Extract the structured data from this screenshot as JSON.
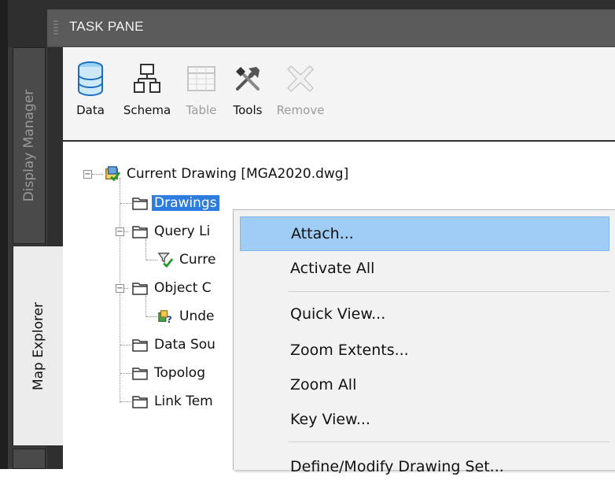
{
  "panel": {
    "title": "TASK PANE"
  },
  "side_tabs": [
    {
      "label": "Display Manager",
      "active": false
    },
    {
      "label": "Map Explorer",
      "active": true
    }
  ],
  "toolbar": {
    "data_label": "Data",
    "schema_label": "Schema",
    "table_label": "Table",
    "tools_label": "Tools",
    "remove_label": "Remove"
  },
  "tree": {
    "root_label": "Current Drawing [MGA2020.dwg]",
    "items": {
      "drawings": "Drawings",
      "query_library": "Query Li",
      "current_query": "Curre",
      "object_classes": "Object C",
      "undefined": "Unde",
      "data_sources": "Data Sou",
      "topologies": "Topolog",
      "link_templates": "Link Tem"
    }
  },
  "context_menu": {
    "attach": "Attach...",
    "activate_all": "Activate All",
    "quick_view": "Quick View...",
    "zoom_extents": "Zoom Extents...",
    "zoom_all": "Zoom All",
    "key_view": "Key View...",
    "define_modify": "Define/Modify Drawing Set..."
  },
  "colors": {
    "selection": "#2d7de0",
    "menu_hover": "#9fcdf6",
    "titlebar": "#5a5a5a"
  }
}
